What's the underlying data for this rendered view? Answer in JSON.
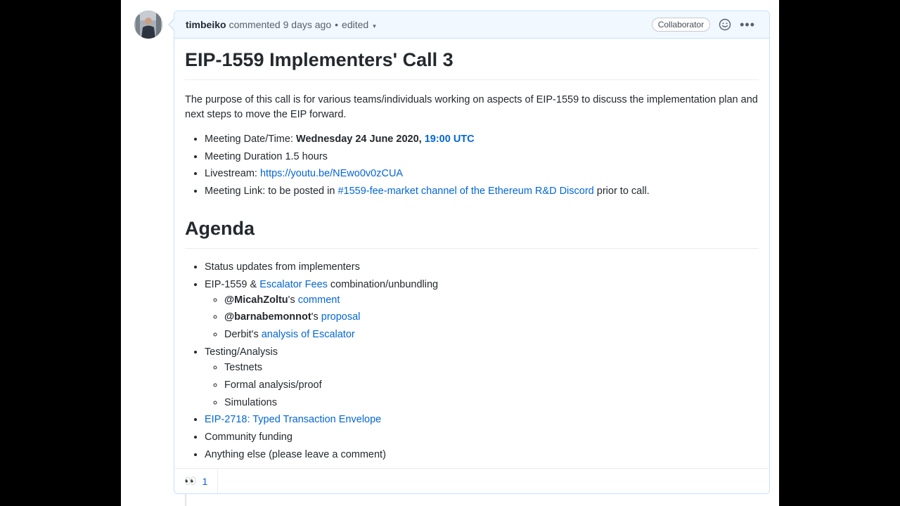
{
  "header": {
    "author": "timbeiko",
    "action": "commented",
    "time": "9 days ago",
    "separator": "•",
    "edited": "edited",
    "badge": "Collaborator"
  },
  "body": {
    "title": "EIP-1559 Implementers' Call 3",
    "intro": "The purpose of this call is for various teams/individuals working on aspects of EIP-1559 to discuss the implementation plan and next steps to move the EIP forward.",
    "meta": {
      "date_label": "Meeting Date/Time: ",
      "date_value": "Wednesday 24 June 2020, ",
      "date_time_link": "19:00 UTC",
      "duration": "Meeting Duration 1.5 hours",
      "livestream_label": "Livestream: ",
      "livestream_link": "https://youtu.be/NEwo0v0zCUA",
      "link_label": "Meeting Link: to be posted in ",
      "link_channel": "#1559-fee-market channel of the Ethereum R&D Discord",
      "link_suffix": " prior to call."
    },
    "agenda_title": "Agenda",
    "agenda": {
      "status": "Status updates from implementers",
      "combo_prefix": "EIP-1559 & ",
      "combo_link": "Escalator Fees",
      "combo_suffix": " combination/unbundling",
      "micah_user": "@MicahZoltu",
      "micah_poss": "'s ",
      "micah_link": "comment",
      "barnabe_user": "@barnabemonnot",
      "barnabe_poss": "'s ",
      "barnabe_link": "proposal",
      "derbit_prefix": "Derbit's ",
      "derbit_link": "analysis of Escalator",
      "testing": "Testing/Analysis",
      "testnets": "Testnets",
      "formal": "Formal analysis/proof",
      "simulations": "Simulations",
      "eip2718": "EIP-2718: Typed Transaction Envelope",
      "funding": "Community funding",
      "anything": "Anything else (please leave a comment)"
    }
  },
  "reactions": {
    "eyes_emoji": "👀",
    "eyes_count": "1"
  }
}
